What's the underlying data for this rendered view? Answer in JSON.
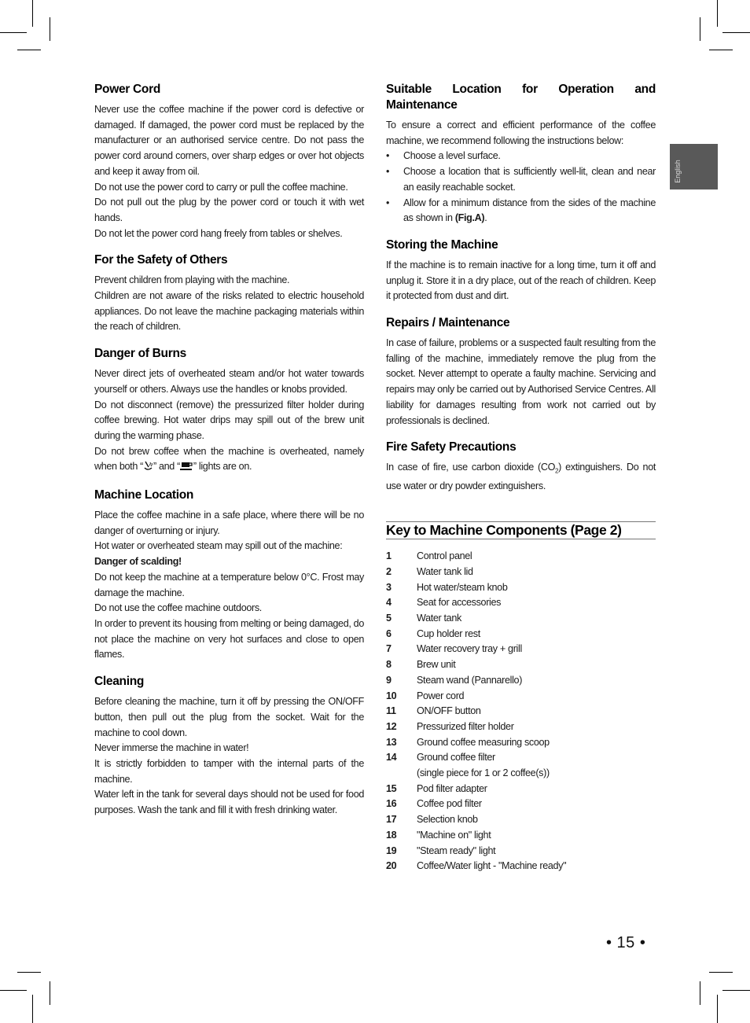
{
  "language_tab": "English",
  "page_number": "• 15 •",
  "left_column": {
    "power_cord": {
      "title": "Power Cord",
      "paragraphs": [
        "Never use the coffee machine if the power cord is defective or damaged. If damaged, the power cord must be replaced by the manufacturer or an authorised service centre. Do not pass the power cord around corners, over sharp edges or over hot objects and keep it away from oil.",
        "Do not use the power cord to carry or pull the coffee machine.",
        "Do not pull out the plug by the power cord or touch it with wet hands.",
        "Do not let the power cord hang freely from tables or shelves."
      ]
    },
    "safety_others": {
      "title": "For the Safety of Others",
      "paragraphs": [
        "Prevent children from playing with the machine.",
        "Children are not aware of the risks related to electric household appliances. Do not leave the machine packaging materials within the reach of children."
      ]
    },
    "danger_burns": {
      "title": "Danger of Burns",
      "paragraphs": [
        "Never direct jets of overheated steam and/or hot water towards yourself or others. Always use the handles or knobs provided.",
        "Do not disconnect (remove) the pressurized filter holder during coffee brewing. Hot water drips may spill out of the brew unit during the warming phase."
      ],
      "overheat_text_before": "Do not brew coffee when the machine is overheated, namely when both “",
      "overheat_text_middle": "” and “",
      "overheat_text_after": "” lights are on.",
      "icons": [
        "steam-wand-icon",
        "coffee-cup-icon"
      ]
    },
    "machine_location": {
      "title": "Machine Location",
      "p1": "Place the coffee machine in a safe place, where there will be no danger of overturning or injury.",
      "p2": "Hot water or overheated steam may spill out of the machine:",
      "p2_bold": "Danger of scalding!",
      "p3": "Do not keep the machine at a temperature below 0°C. Frost may damage the machine.",
      "p4": "Do not use the coffee machine outdoors.",
      "p5": "In order to prevent its housing from melting or being damaged, do not place the machine on very hot surfaces and close to open flames."
    },
    "cleaning": {
      "title": "Cleaning",
      "paragraphs": [
        "Before cleaning the machine, turn it off by pressing the ON/OFF button, then pull out the plug from the socket. Wait for the machine to cool down.",
        "Never immerse the machine in water!",
        "It is strictly forbidden to tamper with the internal parts of the machine.",
        "Water left in the tank for several days should not be used for food purposes. Wash the tank and fill it with fresh drinking water."
      ]
    }
  },
  "right_column": {
    "suitable_location": {
      "title": "Suitable Location for Operation and Maintenance",
      "intro": "To ensure a correct and efficient performance of the coffee machine, we recommend following the instructions below:",
      "bullet_char": "•",
      "bullets": [
        "Choose a level surface.",
        "Choose a location that is sufficiently well-lit, clean and near an easily reachable socket."
      ],
      "bullet3_before": "Allow for a minimum distance from the sides of the machine as shown in ",
      "bullet3_bold": "(Fig.A)",
      "bullet3_after": "."
    },
    "storing": {
      "title": "Storing the Machine",
      "text": "If the machine is to remain inactive for a long time, turn it off and unplug it. Store it in a dry place, out of the reach of children. Keep it protected from dust and dirt."
    },
    "repairs": {
      "title": "Repairs / Maintenance",
      "text": "In case of failure, problems or a suspected fault resulting from the falling of the machine, immediately remove the plug from the socket. Never attempt to operate a faulty machine. Servicing and repairs may only be carried out by Authorised Service Centres. All liability for damages resulting from work not carried out by professionals is declined."
    },
    "fire_safety": {
      "title": "Fire Safety Precautions",
      "text_before": "In case of fire, use carbon dioxide (CO",
      "subscript": "2",
      "text_after": ") extinguishers. Do not use water or dry powder extinguishers."
    },
    "key_components": {
      "title": "Key to Machine Components (Page 2)",
      "items": [
        {
          "num": "1",
          "label": "Control panel"
        },
        {
          "num": "2",
          "label": "Water tank lid"
        },
        {
          "num": "3",
          "label": "Hot water/steam knob"
        },
        {
          "num": "4",
          "label": "Seat for accessories"
        },
        {
          "num": "5",
          "label": "Water tank"
        },
        {
          "num": "6",
          "label": "Cup holder rest"
        },
        {
          "num": "7",
          "label": "Water recovery tray + grill"
        },
        {
          "num": "8",
          "label": "Brew unit"
        },
        {
          "num": "9",
          "label": "Steam wand (Pannarello)"
        },
        {
          "num": "10",
          "label": "Power cord"
        },
        {
          "num": "11",
          "label": "ON/OFF button"
        },
        {
          "num": "12",
          "label": "Pressurized filter holder"
        },
        {
          "num": "13",
          "label": "Ground coffee measuring scoop"
        },
        {
          "num": "14",
          "label": "Ground coffee filter"
        },
        {
          "num": "",
          "label": "(single piece for 1 or 2 coffee(s))"
        },
        {
          "num": "15",
          "label": "Pod filter adapter"
        },
        {
          "num": "16",
          "label": "Coffee pod filter"
        },
        {
          "num": "17",
          "label": "Selection knob"
        },
        {
          "num": "18",
          "label": "\"Machine on\" light"
        },
        {
          "num": "19",
          "label": "\"Steam ready\" light"
        },
        {
          "num": "20",
          "label": "Coffee/Water light - \"Machine ready\""
        }
      ]
    }
  }
}
